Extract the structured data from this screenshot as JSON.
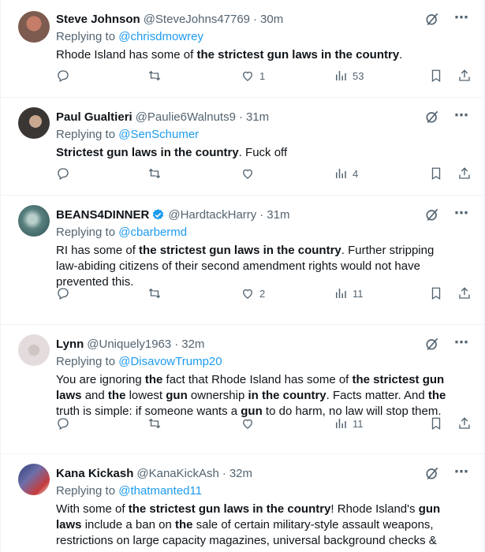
{
  "colors": {
    "accent": "#1d9bf0",
    "muted": "#536471",
    "text": "#0f1419",
    "divider": "#eff3f4"
  },
  "tweets": [
    {
      "name": "Steve Johnson",
      "handle": "@SteveJohns47769",
      "dot": "·",
      "time": "30m",
      "replying_prefix": "Replying to ",
      "replying_to": "@chrisdmowrey",
      "segments": [
        "Rhode Island has some of ",
        "the strictest gun laws in the country",
        "."
      ],
      "counts": {
        "replies": "",
        "retweets": "",
        "likes": "1",
        "views": "53"
      }
    },
    {
      "name": "Paul Gualtieri",
      "handle": "@Paulie6Walnuts9",
      "dot": "·",
      "time": "31m",
      "replying_prefix": "Replying to ",
      "replying_to": "@SenSchumer",
      "segments": [
        "Strictest gun laws in the country",
        ". Fuck off"
      ],
      "counts": {
        "replies": "",
        "retweets": "",
        "likes": "",
        "views": "4"
      }
    },
    {
      "name": "BEANS4DINNER",
      "handle": "@HardtackHarry",
      "dot": "·",
      "time": "31m",
      "replying_prefix": "Replying to ",
      "replying_to": "@cbarbermd",
      "segments": [
        "RI has some of ",
        "the strictest gun laws in the country",
        ". Further stripping law-abiding citizens of their second amendment rights would not have prevented this."
      ],
      "counts": {
        "replies": "",
        "retweets": "",
        "likes": "2",
        "views": "11"
      }
    },
    {
      "name": "Lynn",
      "handle": "@Uniquely1963",
      "dot": "·",
      "time": "32m",
      "replying_prefix": "Replying to ",
      "replying_to": "@DisavowTrump20",
      "segments": [
        "You are ignoring ",
        "the",
        " fact that Rhode Island has some of ",
        "the strictest gun laws",
        " and ",
        "the",
        " lowest ",
        "gun",
        " ownership ",
        "in the country",
        ". Facts matter. And ",
        "the",
        " truth is simple: if someone wants a ",
        "gun",
        " to do harm, no law will stop them."
      ],
      "counts": {
        "replies": "",
        "retweets": "",
        "likes": "",
        "views": "11"
      }
    },
    {
      "name": "Kana Kickash",
      "handle": "@KanaKickAsh",
      "dot": "·",
      "time": "32m",
      "replying_prefix": "Replying to ",
      "replying_to": "@thatmanted11",
      "segments": [
        "With some of ",
        "the strictest gun laws in the country",
        "! Rhode Island's ",
        "gun laws",
        " include a ban on ",
        "the",
        " sale of certain military-style assault weapons, restrictions on large capacity magazines, universal background checks &"
      ],
      "counts": {
        "replies": "",
        "retweets": "",
        "likes": "",
        "views": ""
      }
    }
  ],
  "icons": [
    "verified-badge-icon",
    "grok-icon",
    "more-icon",
    "reply-icon",
    "retweet-icon",
    "like-icon",
    "views-icon",
    "bookmark-icon",
    "share-icon"
  ]
}
